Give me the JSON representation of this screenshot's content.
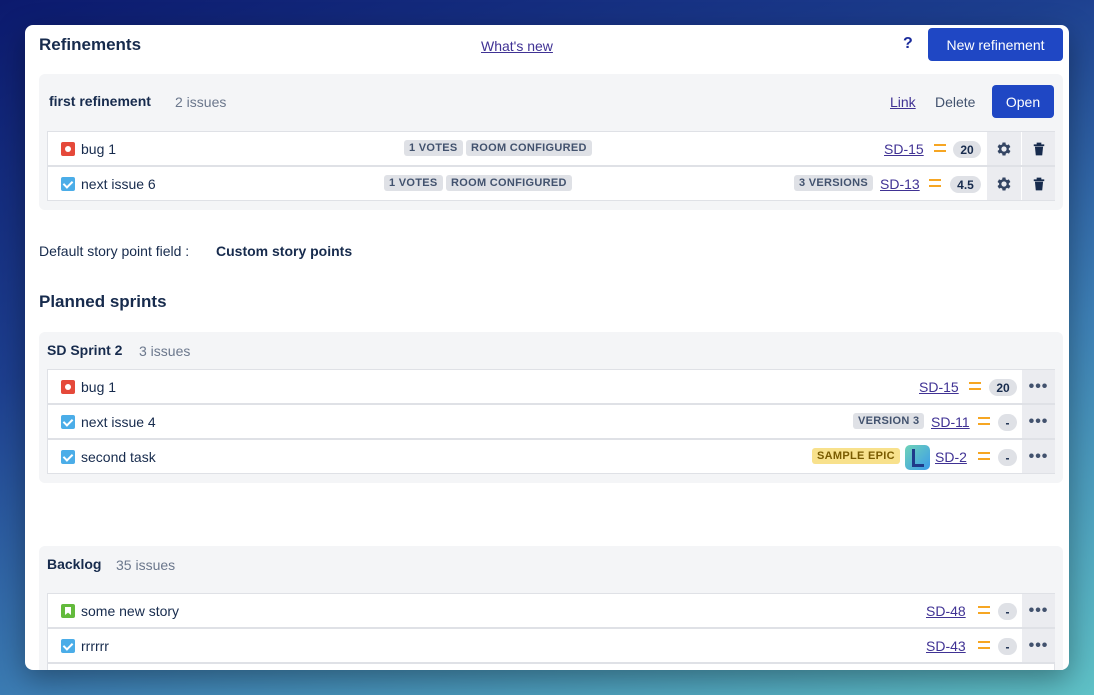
{
  "header": {
    "title": "Refinements",
    "whats_new": "What's new",
    "help": "?",
    "new_button": "New refinement"
  },
  "refinement": {
    "name": "first refinement",
    "count": "2 issues",
    "link": "Link",
    "delete": "Delete",
    "open": "Open",
    "rows": [
      {
        "type": "bug-icon",
        "summary": "bug 1",
        "tags": [
          "1 VOTES",
          "ROOM CONFIGURED"
        ],
        "key": "SD-15",
        "points": "20"
      },
      {
        "type": "task-icon",
        "summary": "next issue 6",
        "tags": [
          "1 VOTES",
          "ROOM CONFIGURED"
        ],
        "versions": "3 VERSIONS",
        "key": "SD-13",
        "points": "4.5"
      }
    ]
  },
  "default_field": {
    "label": "Default story point field :",
    "value": "Custom story points"
  },
  "planned_title": "Planned sprints",
  "sprint": {
    "name": "SD Sprint 2",
    "count": "3 issues",
    "rows": [
      {
        "type": "bug-icon",
        "summary": "bug 1",
        "key": "SD-15",
        "points": "20"
      },
      {
        "type": "task-icon",
        "summary": "next issue 4",
        "version": "VERSION 3",
        "key": "SD-11",
        "points": "-"
      },
      {
        "type": "task-icon",
        "summary": "second task",
        "epic": "SAMPLE EPIC",
        "key": "SD-2",
        "points": "-"
      }
    ]
  },
  "backlog": {
    "name": "Backlog",
    "count": "35 issues",
    "rows": [
      {
        "type": "story-icon",
        "summary": "some new story",
        "key": "SD-48",
        "points": "-"
      },
      {
        "type": "task-icon",
        "summary": "rrrrrr",
        "key": "SD-43",
        "points": "-"
      }
    ]
  },
  "colors": {
    "primary": "#1f47c4",
    "priority": "#f6a623",
    "bug": "#e5493a",
    "task": "#4bade8",
    "story": "#63ba3c"
  }
}
